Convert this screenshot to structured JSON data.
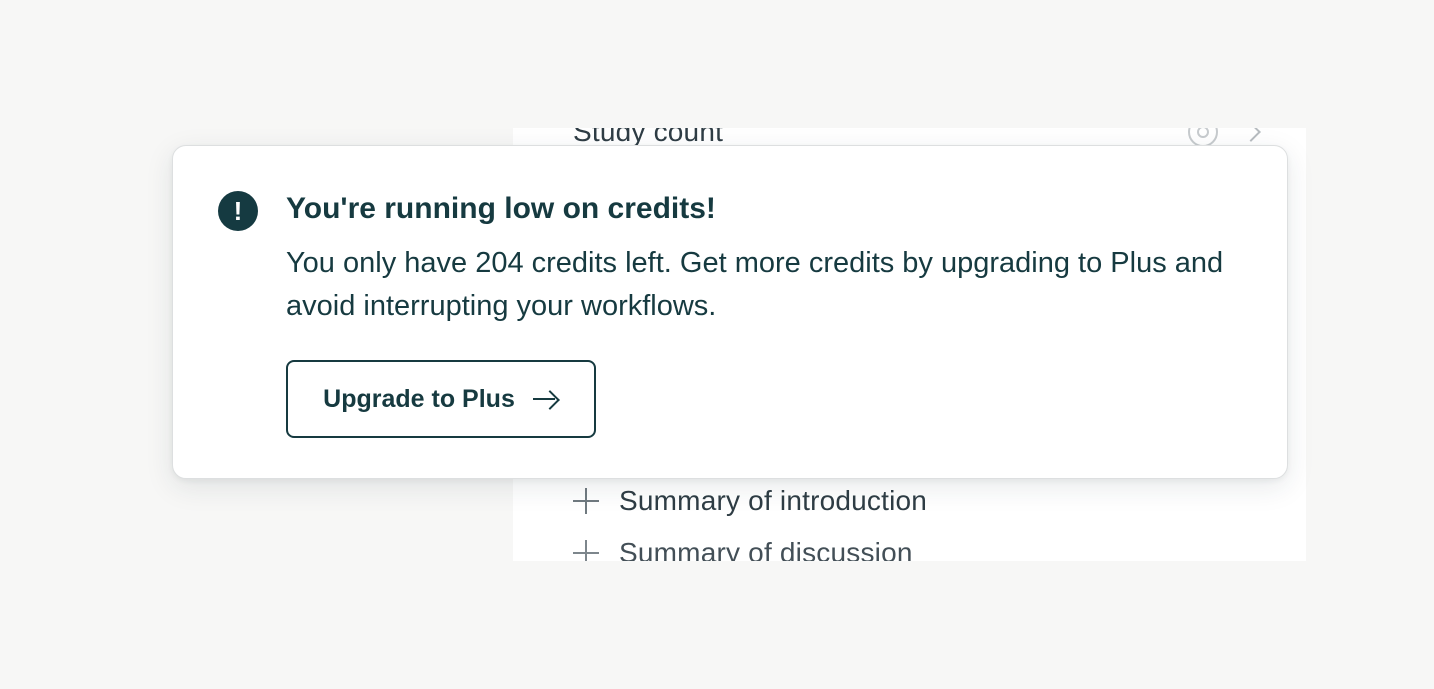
{
  "background": {
    "row_top_label": "Study count",
    "summary_items": [
      {
        "label": "Summary of introduction"
      },
      {
        "label": "Summary of discussion"
      }
    ]
  },
  "notification": {
    "title": "You're running low on credits!",
    "message": "You only have 204 credits left. Get more credits by upgrading to Plus and avoid interrupting your workflows.",
    "button_label": "Upgrade to Plus",
    "alert_symbol": "!",
    "icon": "alert-circle-icon"
  },
  "colors": {
    "accent": "#153a41",
    "page_background": "#f7f7f6",
    "card_background": "#ffffff"
  }
}
